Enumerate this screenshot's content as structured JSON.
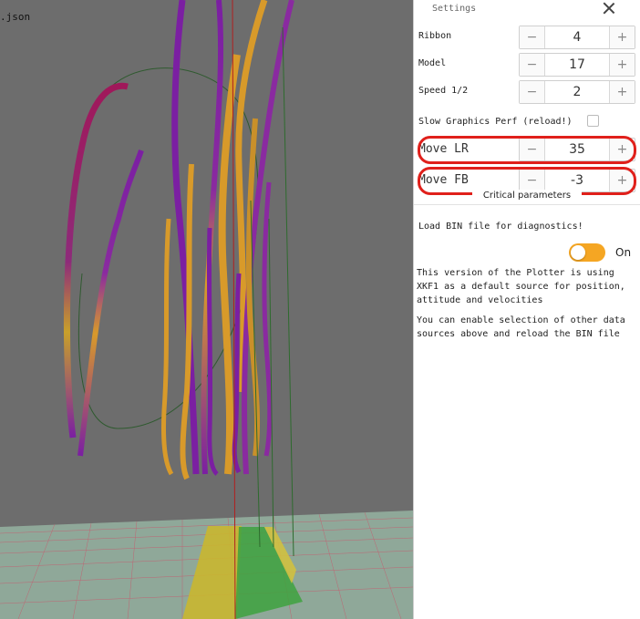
{
  "viewport": {
    "file_label": ".json"
  },
  "settings": {
    "title": "Settings",
    "rows": [
      {
        "label": "Ribbon",
        "value": "4"
      },
      {
        "label": "Model",
        "value": "17"
      },
      {
        "label": "Speed 1/2",
        "value": "2"
      }
    ],
    "minus_glyph": "−",
    "plus_glyph": "+",
    "slow_graphics_label": "Slow Graphics Perf (reload!)",
    "slow_graphics_checked": false,
    "move_rows": [
      {
        "label": "Move LR",
        "value": "35"
      },
      {
        "label": "Move FB",
        "value": "-3"
      }
    ],
    "tooltip": "Critical parameters",
    "load_message": "Load BIN file for diagnostics!",
    "toggle_label": "On",
    "toggle_on": true,
    "info_paragraphs": [
      "This version of the Plotter is using XKF1 as a default source for position, attitude and velocities",
      "You can enable selection of other data sources above and reload the BIN file"
    ]
  },
  "colors": {
    "accent": "#f5a623",
    "highlight": "#e0201b",
    "ribbon_purple": "#7b1fa2",
    "ribbon_orange": "#d89a2a"
  }
}
